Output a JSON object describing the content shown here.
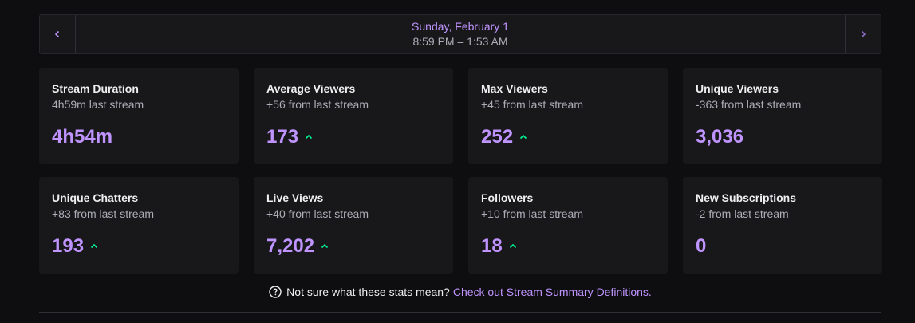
{
  "header": {
    "date": "Sunday, February 1",
    "time_range": "8:59 PM – 1:53 AM",
    "prev_icon": "chevron-left-icon",
    "next_icon": "chevron-right-icon"
  },
  "stats": [
    {
      "title": "Stream Duration",
      "sub": "4h59m last stream",
      "value": "4h54m",
      "trend": "none"
    },
    {
      "title": "Average Viewers",
      "sub": "+56 from last stream",
      "value": "173",
      "trend": "up"
    },
    {
      "title": "Max Viewers",
      "sub": "+45 from last stream",
      "value": "252",
      "trend": "up"
    },
    {
      "title": "Unique Viewers",
      "sub": "-363 from last stream",
      "value": "3,036",
      "trend": "none"
    },
    {
      "title": "Unique Chatters",
      "sub": "+83 from last stream",
      "value": "193",
      "trend": "up"
    },
    {
      "title": "Live Views",
      "sub": "+40 from last stream",
      "value": "7,202",
      "trend": "up"
    },
    {
      "title": "Followers",
      "sub": "+10 from last stream",
      "value": "18",
      "trend": "up"
    },
    {
      "title": "New Subscriptions",
      "sub": "-2 from last stream",
      "value": "0",
      "trend": "none"
    }
  ],
  "footer": {
    "question": "Not sure what these stats mean?",
    "link": "Check out Stream Summary Definitions."
  },
  "colors": {
    "accent": "#bf94ff",
    "trend_up": "#00f593",
    "card_bg": "#18181b",
    "page_bg": "#0e0e10"
  }
}
